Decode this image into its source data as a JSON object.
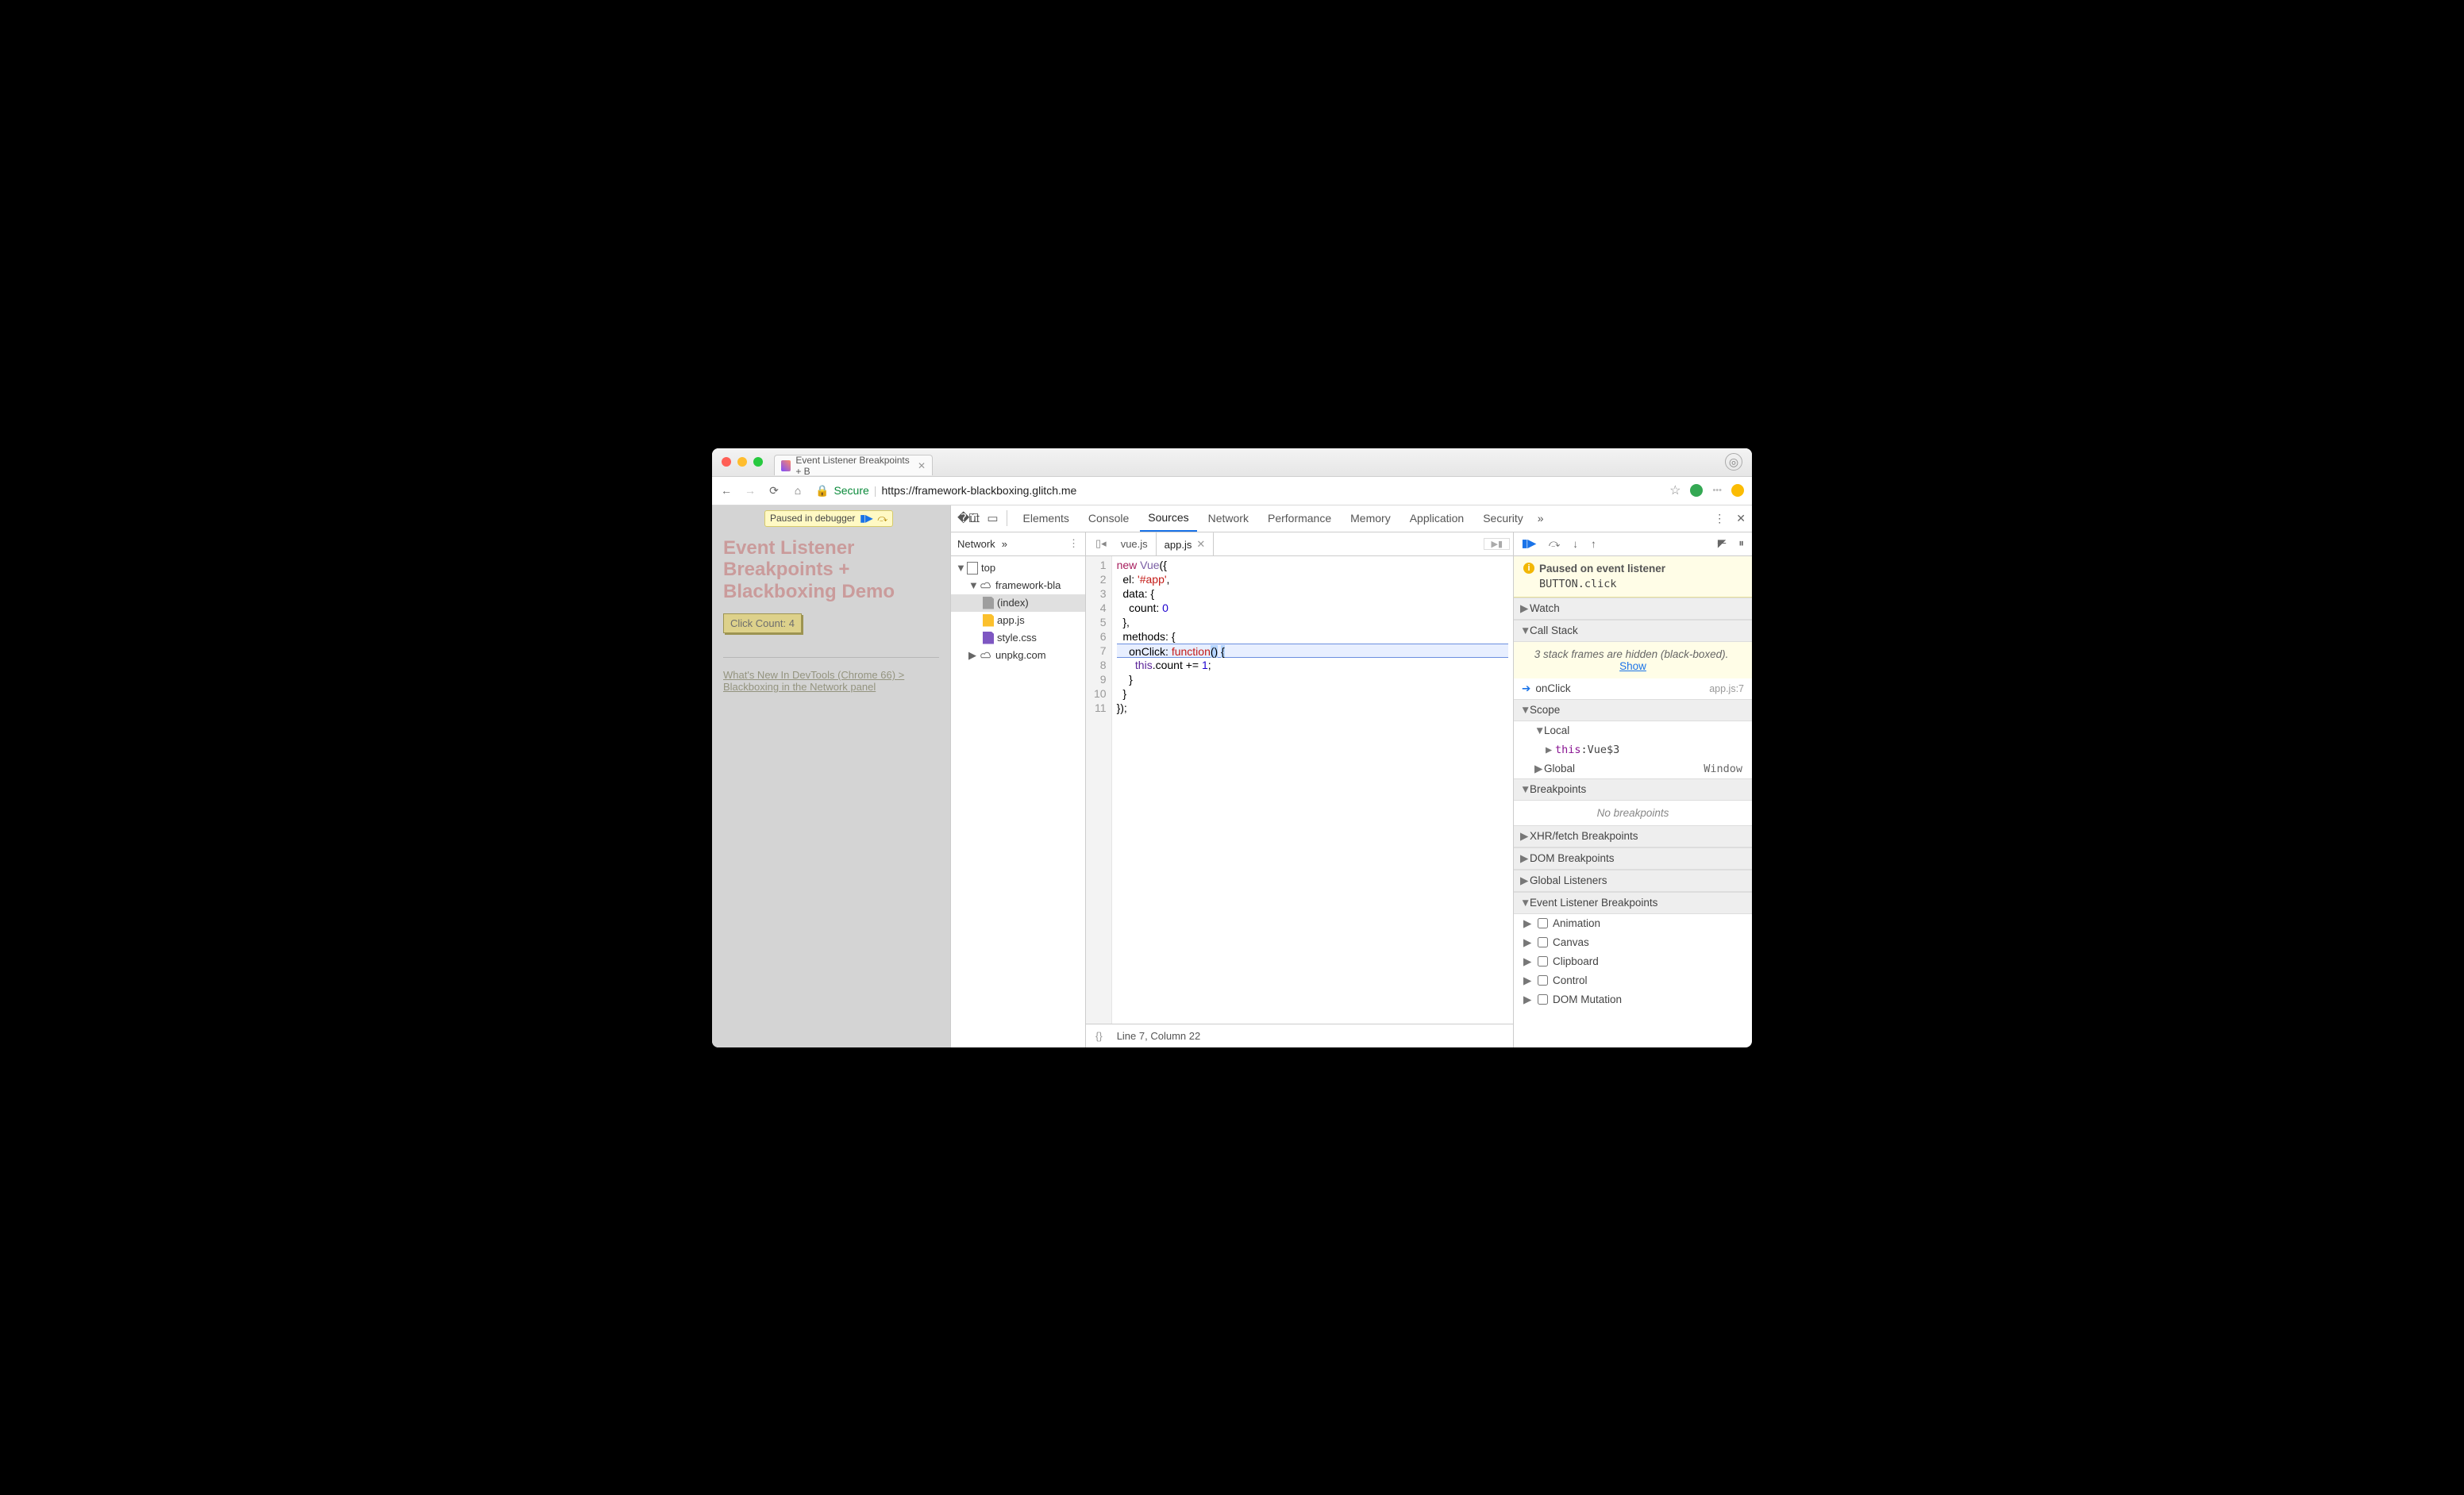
{
  "browser": {
    "tab_title": "Event Listener Breakpoints + B",
    "secure_label": "Secure",
    "url_host": "https://framework-blackboxing.glitch.me",
    "url_path": ""
  },
  "debug_badge": {
    "text": "Paused in debugger",
    "resume_glyph": "▮▶",
    "step_glyph": "⤼"
  },
  "webpage": {
    "heading": "Event Listener Breakpoints + Blackboxing Demo",
    "button_label": "Click Count: 4",
    "link_text": "What's New In DevTools (Chrome 66) > Blackboxing in the Network panel"
  },
  "devtools": {
    "tabs": [
      "Elements",
      "Console",
      "Sources",
      "Network",
      "Performance",
      "Memory",
      "Application",
      "Security"
    ],
    "active_tab": "Sources",
    "more_glyph": "»"
  },
  "files": {
    "nav_tab": "Network",
    "top": "top",
    "domain": "framework-bla",
    "items": [
      "(index)",
      "app.js",
      "style.css"
    ],
    "cdn": "unpkg.com"
  },
  "editor": {
    "tabs": [
      "vue.js",
      "app.js"
    ],
    "active": "app.js",
    "lines": [
      "new Vue({",
      "  el: '#app',",
      "  data: {",
      "    count: 0",
      "  },",
      "  methods: {",
      "    onClick: function() {",
      "      this.count += 1;",
      "    }",
      "  }",
      "});"
    ],
    "paused_line": 7,
    "status": "Line 7, Column 22",
    "braces": "{}"
  },
  "debugger": {
    "paused_title": "Paused on event listener",
    "paused_detail": "BUTTON.click",
    "sections": {
      "watch": "Watch",
      "callstack": "Call Stack",
      "scope": "Scope",
      "breakpoints": "Breakpoints",
      "xhr": "XHR/fetch Breakpoints",
      "dom": "DOM Breakpoints",
      "global_listeners": "Global Listeners",
      "event_listener": "Event Listener Breakpoints"
    },
    "blackbox_note": "3 stack frames are hidden (black-boxed).",
    "blackbox_show": "Show",
    "stack_frame": {
      "name": "onClick",
      "loc": "app.js:7"
    },
    "scope": {
      "local": "Local",
      "this_label": "this",
      "this_value": "Vue$3",
      "global": "Global",
      "global_value": "Window"
    },
    "no_breakpoints": "No breakpoints",
    "event_categories": [
      "Animation",
      "Canvas",
      "Clipboard",
      "Control",
      "DOM Mutation"
    ]
  }
}
